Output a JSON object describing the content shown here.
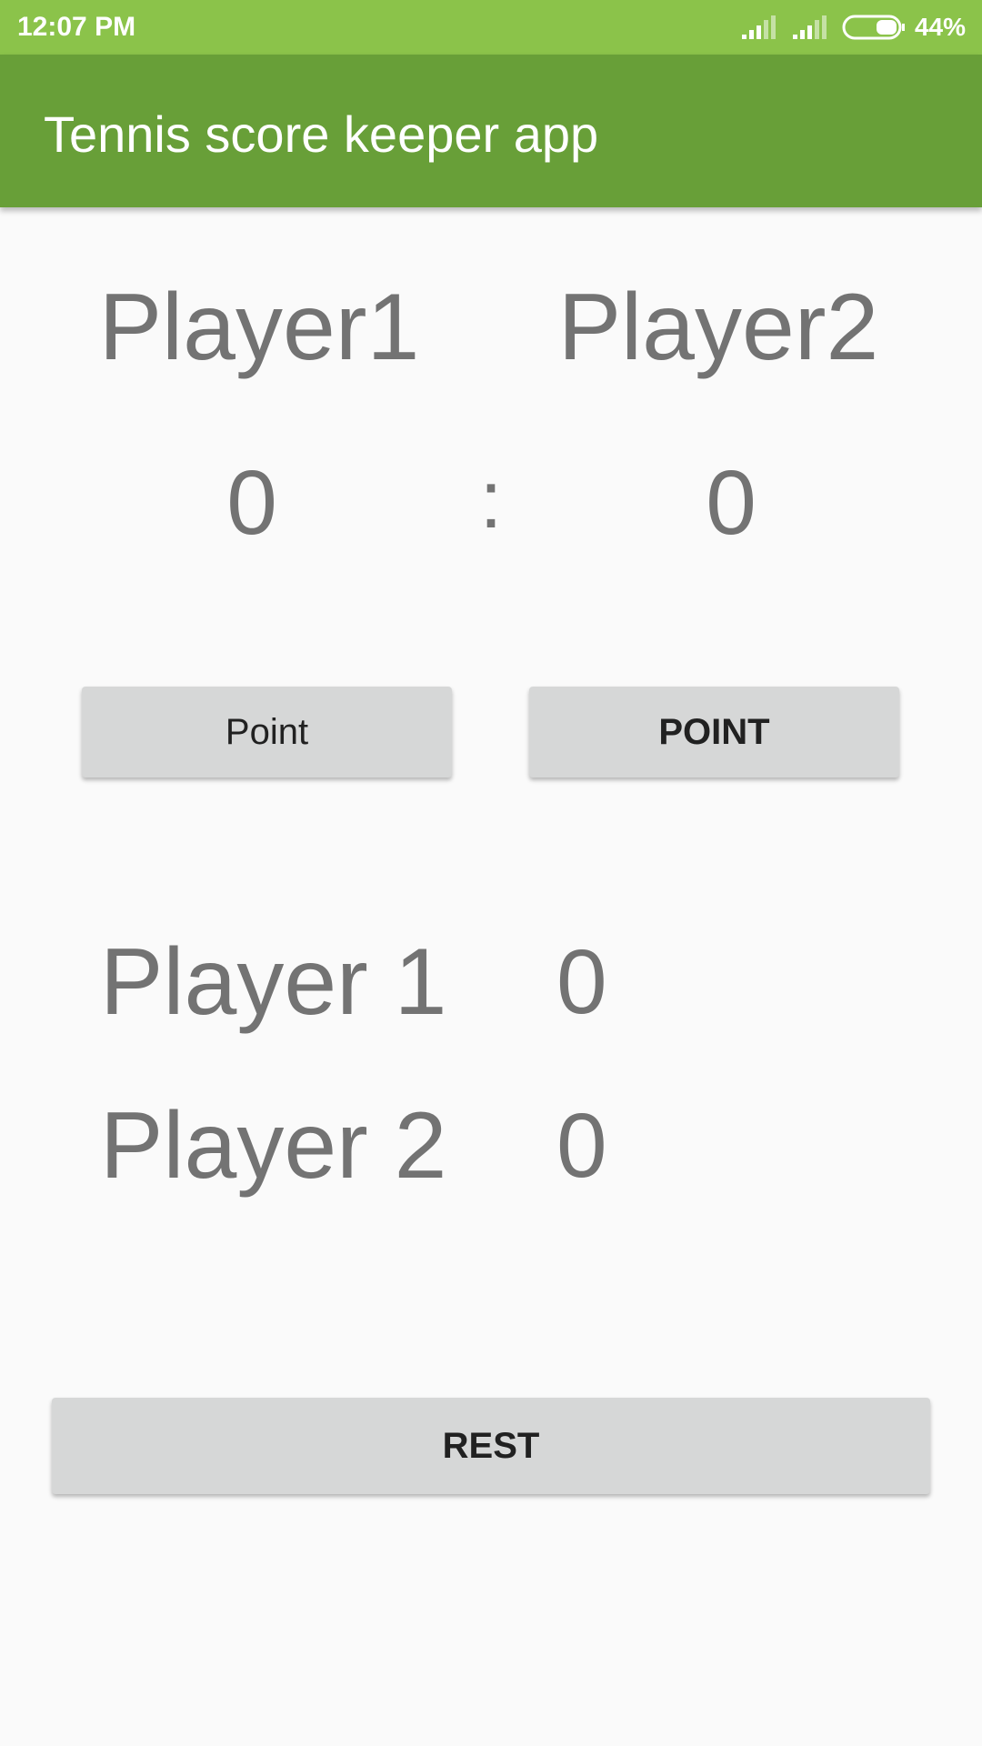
{
  "status_bar": {
    "time": "12:07 PM",
    "battery": "44%",
    "color": "#8bc34a"
  },
  "app_bar": {
    "title": "Tennis score keeper app",
    "color": "#689f38"
  },
  "scoreboard": {
    "player1_name": "Player1",
    "player2_name": "Player2",
    "player1_score": "0",
    "separator": ":",
    "player2_score": "0"
  },
  "buttons": {
    "player1_point": "Point",
    "player2_point": "POINT",
    "reset": "REST"
  },
  "summary": {
    "rows": [
      {
        "name": "Player 1",
        "score": "0"
      },
      {
        "name": "Player 2",
        "score": "0"
      }
    ]
  },
  "icons": [
    "signal-icon",
    "signal-icon",
    "battery-icon"
  ]
}
